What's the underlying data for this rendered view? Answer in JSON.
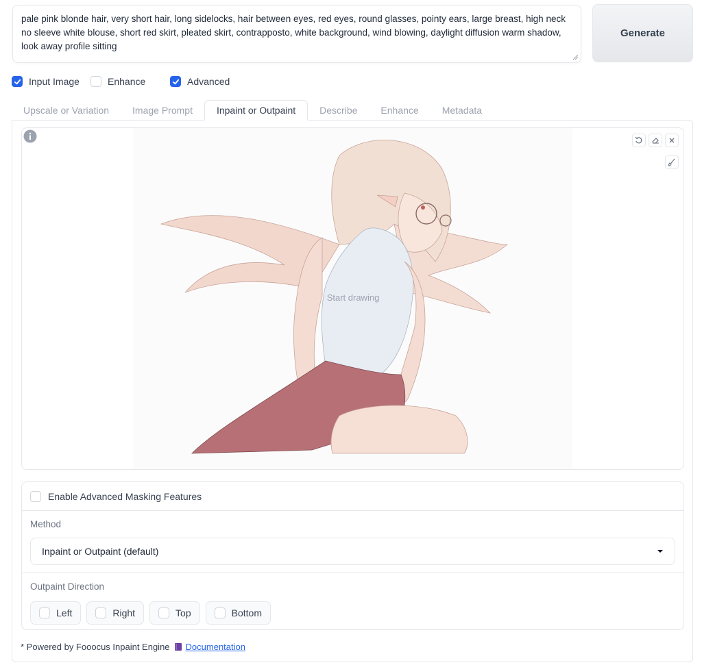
{
  "prompt": {
    "text": "pale pink blonde hair, very short hair, long sidelocks, hair between eyes, red eyes, round glasses, pointy ears, large breast, high neck no sleeve white blouse, short red skirt, pleated skirt, contrapposto, white background, wind blowing, daylight diffusion warm shadow, look away profile sitting"
  },
  "generate_label": "Generate",
  "options": [
    {
      "label": "Input Image",
      "checked": true
    },
    {
      "label": "Enhance",
      "checked": false
    },
    {
      "label": "Advanced",
      "checked": true
    }
  ],
  "tabs": [
    {
      "label": "Upscale or Variation",
      "active": false
    },
    {
      "label": "Image Prompt",
      "active": false
    },
    {
      "label": "Inpaint or Outpaint",
      "active": true
    },
    {
      "label": "Describe",
      "active": false
    },
    {
      "label": "Enhance",
      "active": false
    },
    {
      "label": "Metadata",
      "active": false
    }
  ],
  "canvas": {
    "placeholder": "Start drawing",
    "icons": [
      "undo-icon",
      "eraser-icon",
      "close-icon",
      "brush-icon",
      "info-icon"
    ]
  },
  "masking": {
    "enable_label": "Enable Advanced Masking Features",
    "method_label": "Method",
    "method_value": "Inpaint or Outpaint (default)",
    "direction_label": "Outpaint Direction",
    "directions": [
      "Left",
      "Right",
      "Top",
      "Bottom"
    ]
  },
  "footer": {
    "text": "* Powered by Fooocus Inpaint Engine",
    "link_label": "Documentation"
  },
  "colors": {
    "accent": "#2563eb",
    "border": "#e5e7eb"
  }
}
